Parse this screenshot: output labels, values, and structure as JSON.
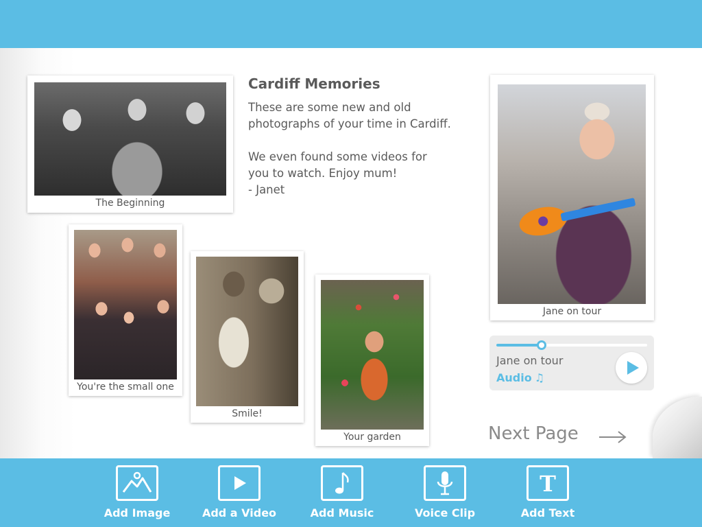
{
  "colors": {
    "accent": "#5bbde4",
    "text": "#5a5a5a",
    "caption": "#555555"
  },
  "story": {
    "title": "Cardiff Memories",
    "lines": [
      "These are some new and old",
      "photographs of your time in Cardiff.",
      "We even found some videos for",
      "you to watch. Enjoy mum!",
      "- Janet"
    ]
  },
  "photos": {
    "beginning": {
      "caption": "The Beginning"
    },
    "small_one": {
      "caption": "You're the small one"
    },
    "smile": {
      "caption": "Smile!"
    },
    "garden": {
      "caption": "Your garden"
    },
    "jane_tour": {
      "caption": "Jane on tour"
    }
  },
  "audio": {
    "title": "Jane on tour",
    "type": "Audio",
    "note_icon": "music-note-icon",
    "progress": 0.3
  },
  "navigation": {
    "next_label": "Next Page"
  },
  "toolbar": [
    {
      "label": "Add Image",
      "icon": "image-icon"
    },
    {
      "label": "Add a Video",
      "icon": "video-play-icon"
    },
    {
      "label": "Add Music",
      "icon": "music-note-icon"
    },
    {
      "label": "Voice Clip",
      "icon": "microphone-icon"
    },
    {
      "label": "Add Text",
      "icon": "text-icon"
    }
  ]
}
